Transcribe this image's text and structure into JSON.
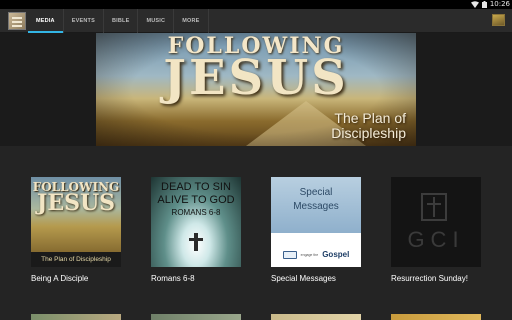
{
  "status_bar": {
    "time": "10:26"
  },
  "tabs": [
    {
      "label": "MEDIA",
      "active": true
    },
    {
      "label": "EVENTS",
      "active": false
    },
    {
      "label": "BIBLE",
      "active": false
    },
    {
      "label": "MUSIC",
      "active": false
    },
    {
      "label": "MORE",
      "active": false
    }
  ],
  "banner": {
    "line1": "FOLLOWING",
    "line2": "JESUS",
    "line3": "The Plan of Discipleship"
  },
  "media_items": [
    {
      "title": "Being A Disciple",
      "art_line1": "FOLLOWING",
      "art_line2": "JESUS",
      "art_caption": "The Plan of Discipleship"
    },
    {
      "title": "Romans 6-8",
      "art_line1": "DEAD TO SIN",
      "art_line2": "ALIVE TO GOD",
      "art_line3": "ROMANS 6-8"
    },
    {
      "title": "Special Messages",
      "art_line1": "Special",
      "art_line2": "Messages",
      "art_small": "engage the",
      "art_brand": "Gospel"
    },
    {
      "title": "Resurrection Sunday!",
      "art_text": "GCI"
    }
  ],
  "colors": {
    "accent": "#33b5e5",
    "background": "#242424",
    "tabbar": "#2b2b2b"
  }
}
